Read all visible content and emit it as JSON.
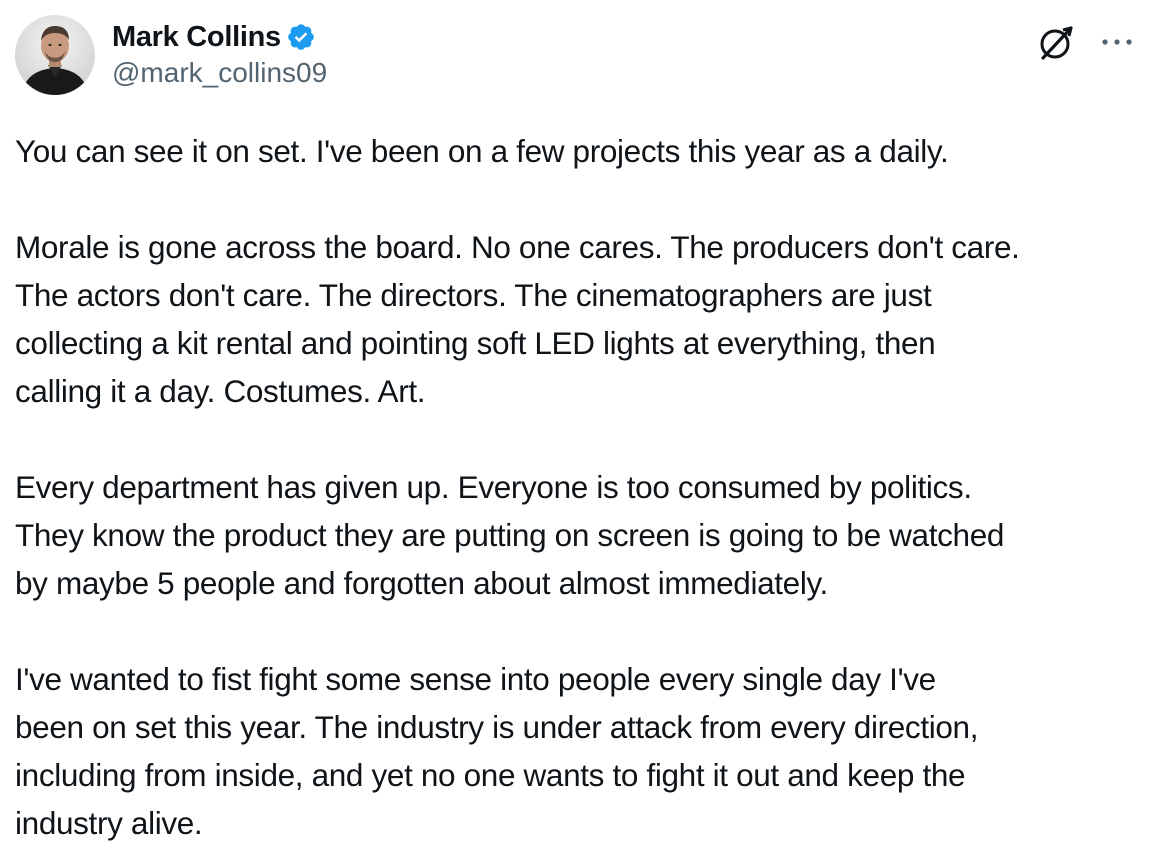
{
  "author": {
    "display_name": "Mark Collins",
    "handle": "@mark_collins09",
    "verified": true,
    "verified_color": "#1d9bf0"
  },
  "actions": {
    "grok_icon": "grok-icon",
    "more_icon": "more-icon"
  },
  "post": {
    "paragraphs": [
      {
        "lines": [
          "You can see it on set. I've been on a few projects this year as a daily."
        ]
      },
      {
        "lines": [
          "Morale is gone across the board. No one cares. The producers don't care.",
          "The actors don't care. The directors. The cinematographers are just",
          "collecting a kit rental and pointing soft LED lights at everything, then",
          "calling it a day. Costumes. Art."
        ]
      },
      {
        "lines": [
          "Every department has given up. Everyone is too consumed by politics.",
          "They know the product they are putting on screen is going to be watched",
          "by maybe 5 people and forgotten about almost immediately."
        ]
      },
      {
        "lines": [
          "I've wanted to fist fight some sense into people every single day I've",
          "been on set this year. The industry is under attack from every direction,",
          "including from inside, and yet no one wants to fight it out and keep the",
          "industry alive."
        ]
      }
    ]
  }
}
